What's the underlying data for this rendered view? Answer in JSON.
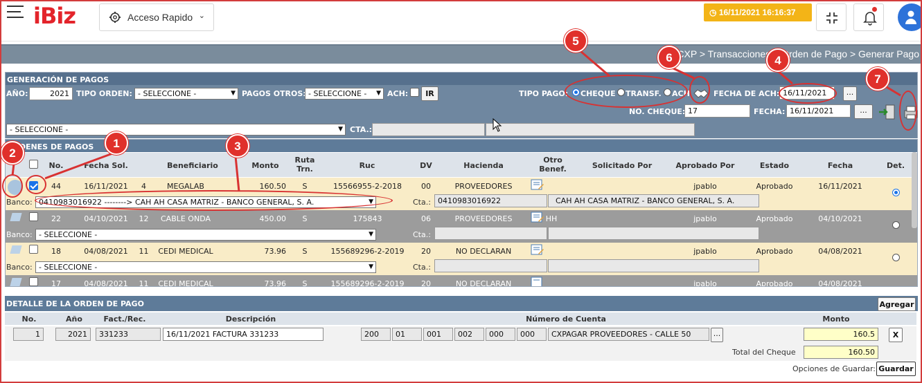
{
  "app": {
    "logo": "iBiz",
    "quick_access": "Acceso Rapido",
    "datetime": "16/11/2021 16:16:37"
  },
  "breadcrumb": "CXP > Transacciones > Orden de Pago > Generar Pago",
  "generation": {
    "title": "GENERACIÓN DE PAGOS",
    "year_label": "AÑO:",
    "year": "2021",
    "order_type_label": "TIPO ORDEN:",
    "order_type": "- SELECCIONE -",
    "other_payments_label": "PAGOS OTROS:",
    "other_payments": "- SELECCIONE -",
    "ach_label": "ACH:",
    "go_button": "IR",
    "payment_type_label": "TIPO PAGO:",
    "payment_types": [
      "CHEQUE",
      "TRANSF.",
      "ACH"
    ],
    "ach_date_label": "FECHA DE ACH:",
    "ach_date": "16/11/2021",
    "ellipsis": "...",
    "check_no_label": "NO. CHEQUE:",
    "check_no": "17",
    "date_label": "FECHA:",
    "date": "16/11/2021",
    "bank_select": "- SELECCIONE -",
    "account_label": "CTA.:"
  },
  "orders": {
    "title": "ÓRDENES DE PAGOS",
    "columns": [
      "No.",
      "Fecha Sol.",
      "Beneficiario",
      "Monto",
      "Ruta Trn.",
      "Ruc",
      "DV",
      "Hacienda",
      "Otro Benef.",
      "Solicitado Por",
      "Aprobado Por",
      "Estado",
      "Fecha",
      "Det."
    ],
    "bank_label": "Banco:",
    "account_label": "Cta.:",
    "rows": [
      {
        "no": "44",
        "fecha_sol": "16/11/2021",
        "code": "4",
        "beneficiario": "MEGALAB",
        "monto": "160.50",
        "ruta": "S",
        "ruc": "15566955-2-2018",
        "dv": "00",
        "hacienda": "PROVEEDORES",
        "otro": "",
        "solicitado": "",
        "aprobado": "jpablo",
        "estado": "Aprobado",
        "fecha": "16/11/2021",
        "bank": "0410983016922 --------> CAH AH CASA MATRIZ - BANCO GENERAL, S. A.",
        "cta": "0410983016922",
        "cta_name": "CAH AH CASA MATRIZ - BANCO GENERAL, S. A."
      },
      {
        "no": "22",
        "fecha_sol": "04/10/2021",
        "code": "12",
        "beneficiario": "CABLE ONDA",
        "monto": "450.00",
        "ruta": "S",
        "ruc": "175843",
        "dv": "06",
        "hacienda": "PROVEEDORES",
        "otro": "HH",
        "solicitado": "",
        "aprobado": "jpablo",
        "estado": "Aprobado",
        "fecha": "04/10/2021",
        "bank": "- SELECCIONE -",
        "cta": "",
        "cta_name": ""
      },
      {
        "no": "18",
        "fecha_sol": "04/08/2021",
        "code": "11",
        "beneficiario": "CEDI MEDICAL",
        "monto": "73.96",
        "ruta": "S",
        "ruc": "155689296-2-2019",
        "dv": "20",
        "hacienda": "NO DECLARAN",
        "otro": "",
        "solicitado": "",
        "aprobado": "jpablo",
        "estado": "Aprobado",
        "fecha": "04/08/2021",
        "bank": "- SELECCIONE -",
        "cta": "",
        "cta_name": ""
      },
      {
        "no": "17",
        "fecha_sol": "04/08/2021",
        "code": "11",
        "beneficiario": "CEDI MEDICAL",
        "monto": "73.96",
        "ruta": "S",
        "ruc": "155689296-2-2019",
        "dv": "20",
        "hacienda": "NO DECLARAN",
        "otro": "",
        "solicitado": "",
        "aprobado": "jpablo",
        "estado": "Aprobado",
        "fecha": "04/08/2021"
      }
    ]
  },
  "detail": {
    "title": "DETALLE DE LA ORDEN DE PAGO",
    "add_button": "Agregar",
    "columns": [
      "No.",
      "Año",
      "Fact./Rec.",
      "Descripción",
      "Número de Cuenta",
      "Monto"
    ],
    "line": {
      "no": "1",
      "year": "2021",
      "invoice": "331233",
      "description": "16/11/2021 FACTURA 331233",
      "acct": [
        "200",
        "01",
        "001",
        "002",
        "000",
        "000"
      ],
      "acct_name": "CXPAGAR PROVEEDORES - CALLE 50",
      "amount": "160.5"
    },
    "delete_button": "X",
    "total_label": "Total del Cheque",
    "total": "160.50",
    "save_options_label": "Opciones de Guardar:",
    "save_button": "Guardar"
  },
  "annotations": [
    "1",
    "2",
    "3",
    "4",
    "5",
    "6",
    "7"
  ]
}
